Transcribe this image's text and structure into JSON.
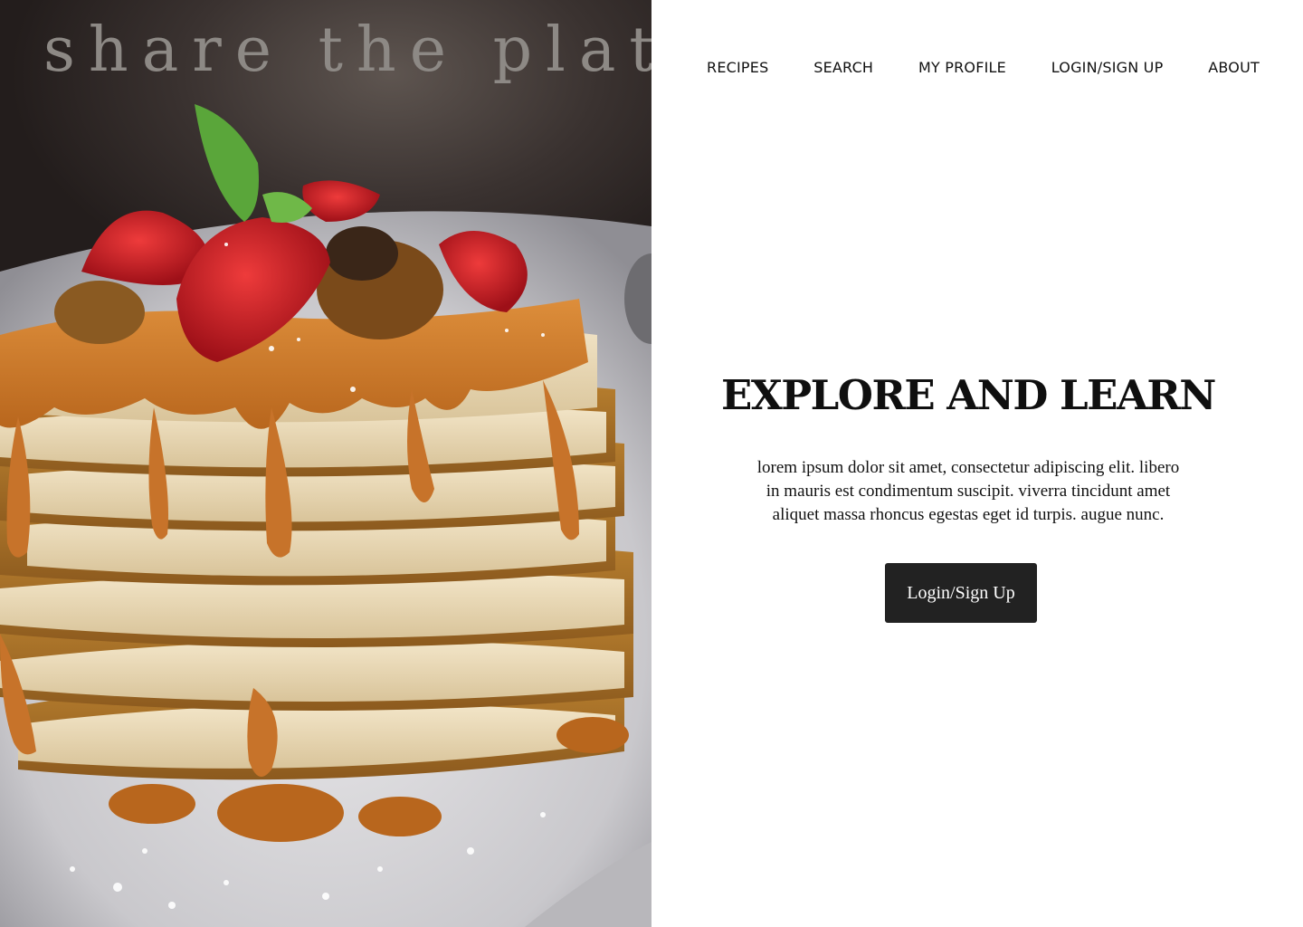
{
  "brand": {
    "name": "share the plate"
  },
  "nav": {
    "items": [
      {
        "label": "RECIPES"
      },
      {
        "label": "SEARCH"
      },
      {
        "label": "MY PROFILE"
      },
      {
        "label": "LOGIN/SIGN UP"
      },
      {
        "label": "ABOUT"
      }
    ]
  },
  "hero": {
    "headline": "EXPLORE AND LEARN",
    "body": "lorem ipsum dolor sit amet, consectetur adipiscing elit. libero in mauris est condimentum suscipit. viverra tincidunt amet aliquet massa rhoncus egestas eget id turpis. augue nunc.",
    "cta_label": "Login/Sign Up"
  },
  "colors": {
    "button_bg": "#222222",
    "brand_text": "#8d8985",
    "caramel": "#c97a2a",
    "strawberry": "#c8202a"
  }
}
